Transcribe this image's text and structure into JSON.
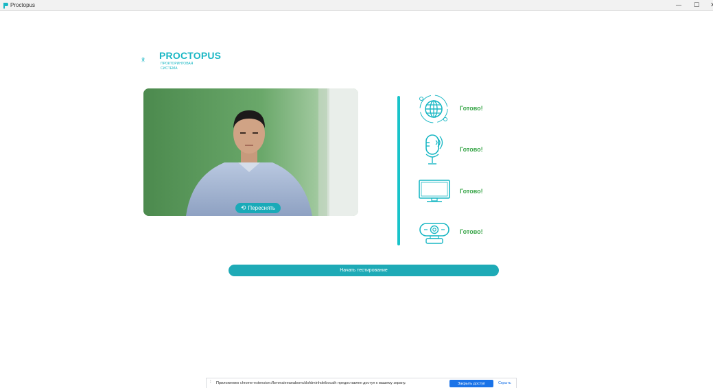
{
  "window": {
    "title": "Proctopus",
    "minimize_glyph": "—",
    "maximize_glyph": "☐",
    "close_glyph": "✕"
  },
  "logo": {
    "name": "PROCTOPUS",
    "subtitle_line1": "ПРОКТОРИНГОВАЯ",
    "subtitle_line2": "СИСТЕМА"
  },
  "camera": {
    "retake_label": "Переснять",
    "retake_icon": "undo-arrow-icon"
  },
  "checks": [
    {
      "icon": "internet-globe-icon",
      "status": "Готово!"
    },
    {
      "icon": "microphone-icon",
      "status": "Готово!"
    },
    {
      "icon": "monitor-icon",
      "status": "Готово!"
    },
    {
      "icon": "webcam-icon",
      "status": "Готово!"
    }
  ],
  "actions": {
    "start_label": "Начать тестирование"
  },
  "screen_share": {
    "message": "Приложению chrome-extension://bmmaieeaeabomcklofdminhdeibocaih предоставлен доступ к вашему экрану.",
    "stop_label": "Закрыть доступ",
    "hide_label": "Скрыть"
  },
  "colors": {
    "brand": "#19b7c4",
    "button": "#1eaab6",
    "success": "#3aa64a",
    "chrome_blue": "#1a73e8"
  }
}
